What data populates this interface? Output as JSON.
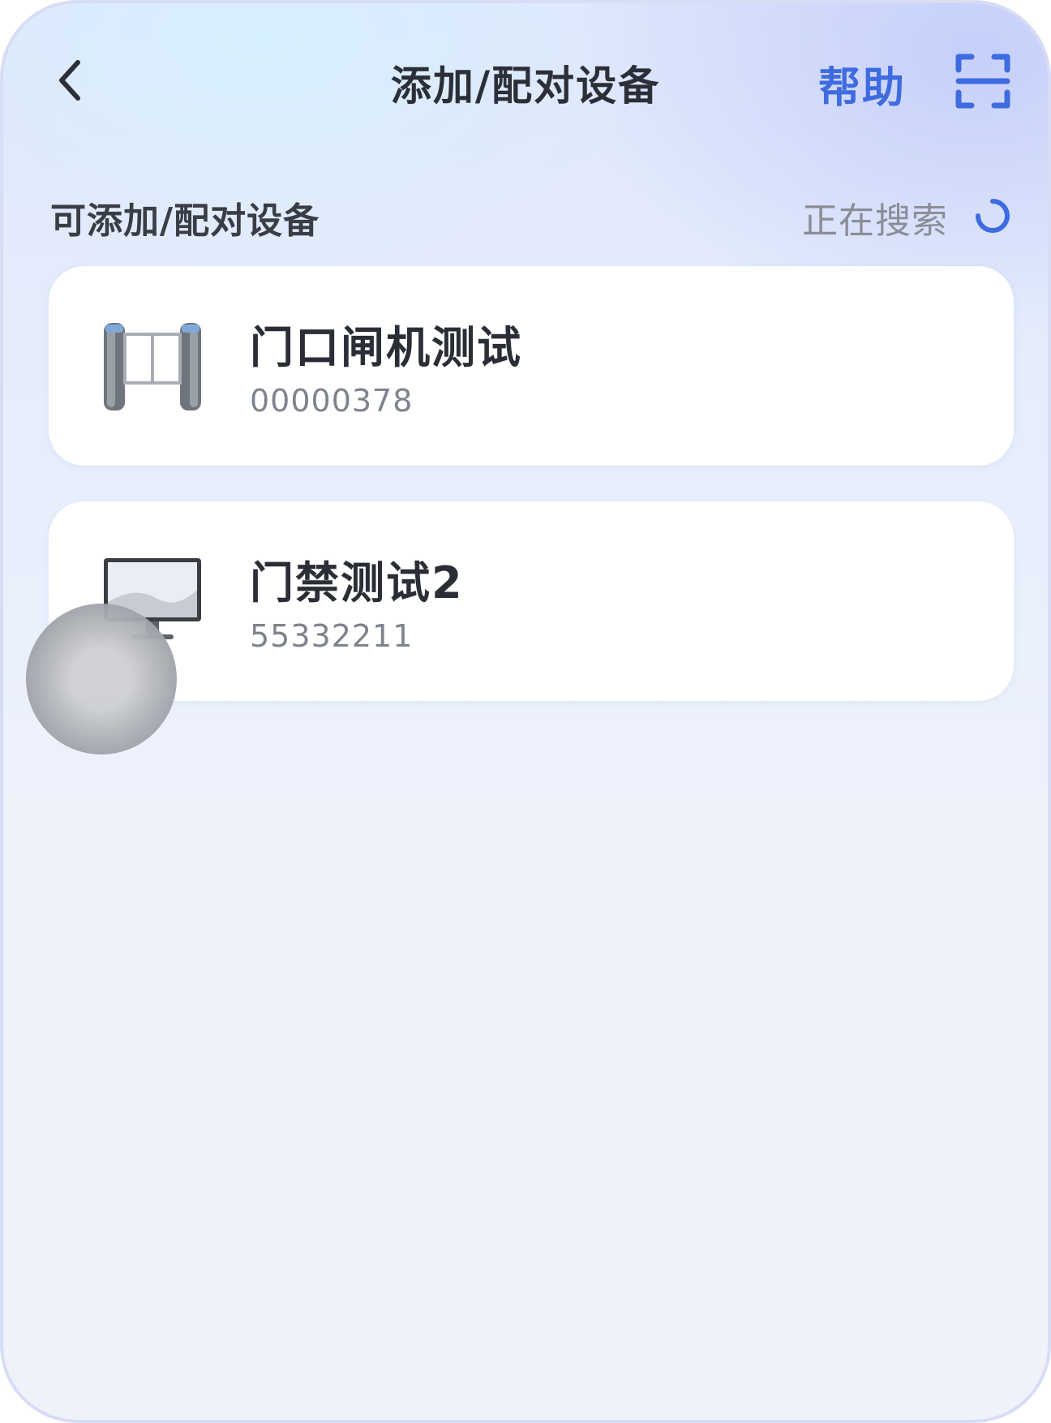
{
  "header": {
    "title": "添加/配对设备",
    "help_label": "帮助",
    "back_icon": "chevron-left-icon",
    "scan_icon": "scan-icon"
  },
  "section": {
    "title": "可添加/配对设备",
    "status": "正在搜索"
  },
  "devices": [
    {
      "name": "门口闸机测试",
      "serial": "00000378",
      "icon": "turnstile-gate-icon"
    },
    {
      "name": "门禁测试2",
      "serial": "55332211",
      "icon": "access-control-terminal-icon"
    }
  ],
  "colors": {
    "accent": "#3f6be0",
    "title_text": "#2c2f38",
    "secondary_text": "#8a8d96",
    "card_bg": "#ffffff"
  }
}
